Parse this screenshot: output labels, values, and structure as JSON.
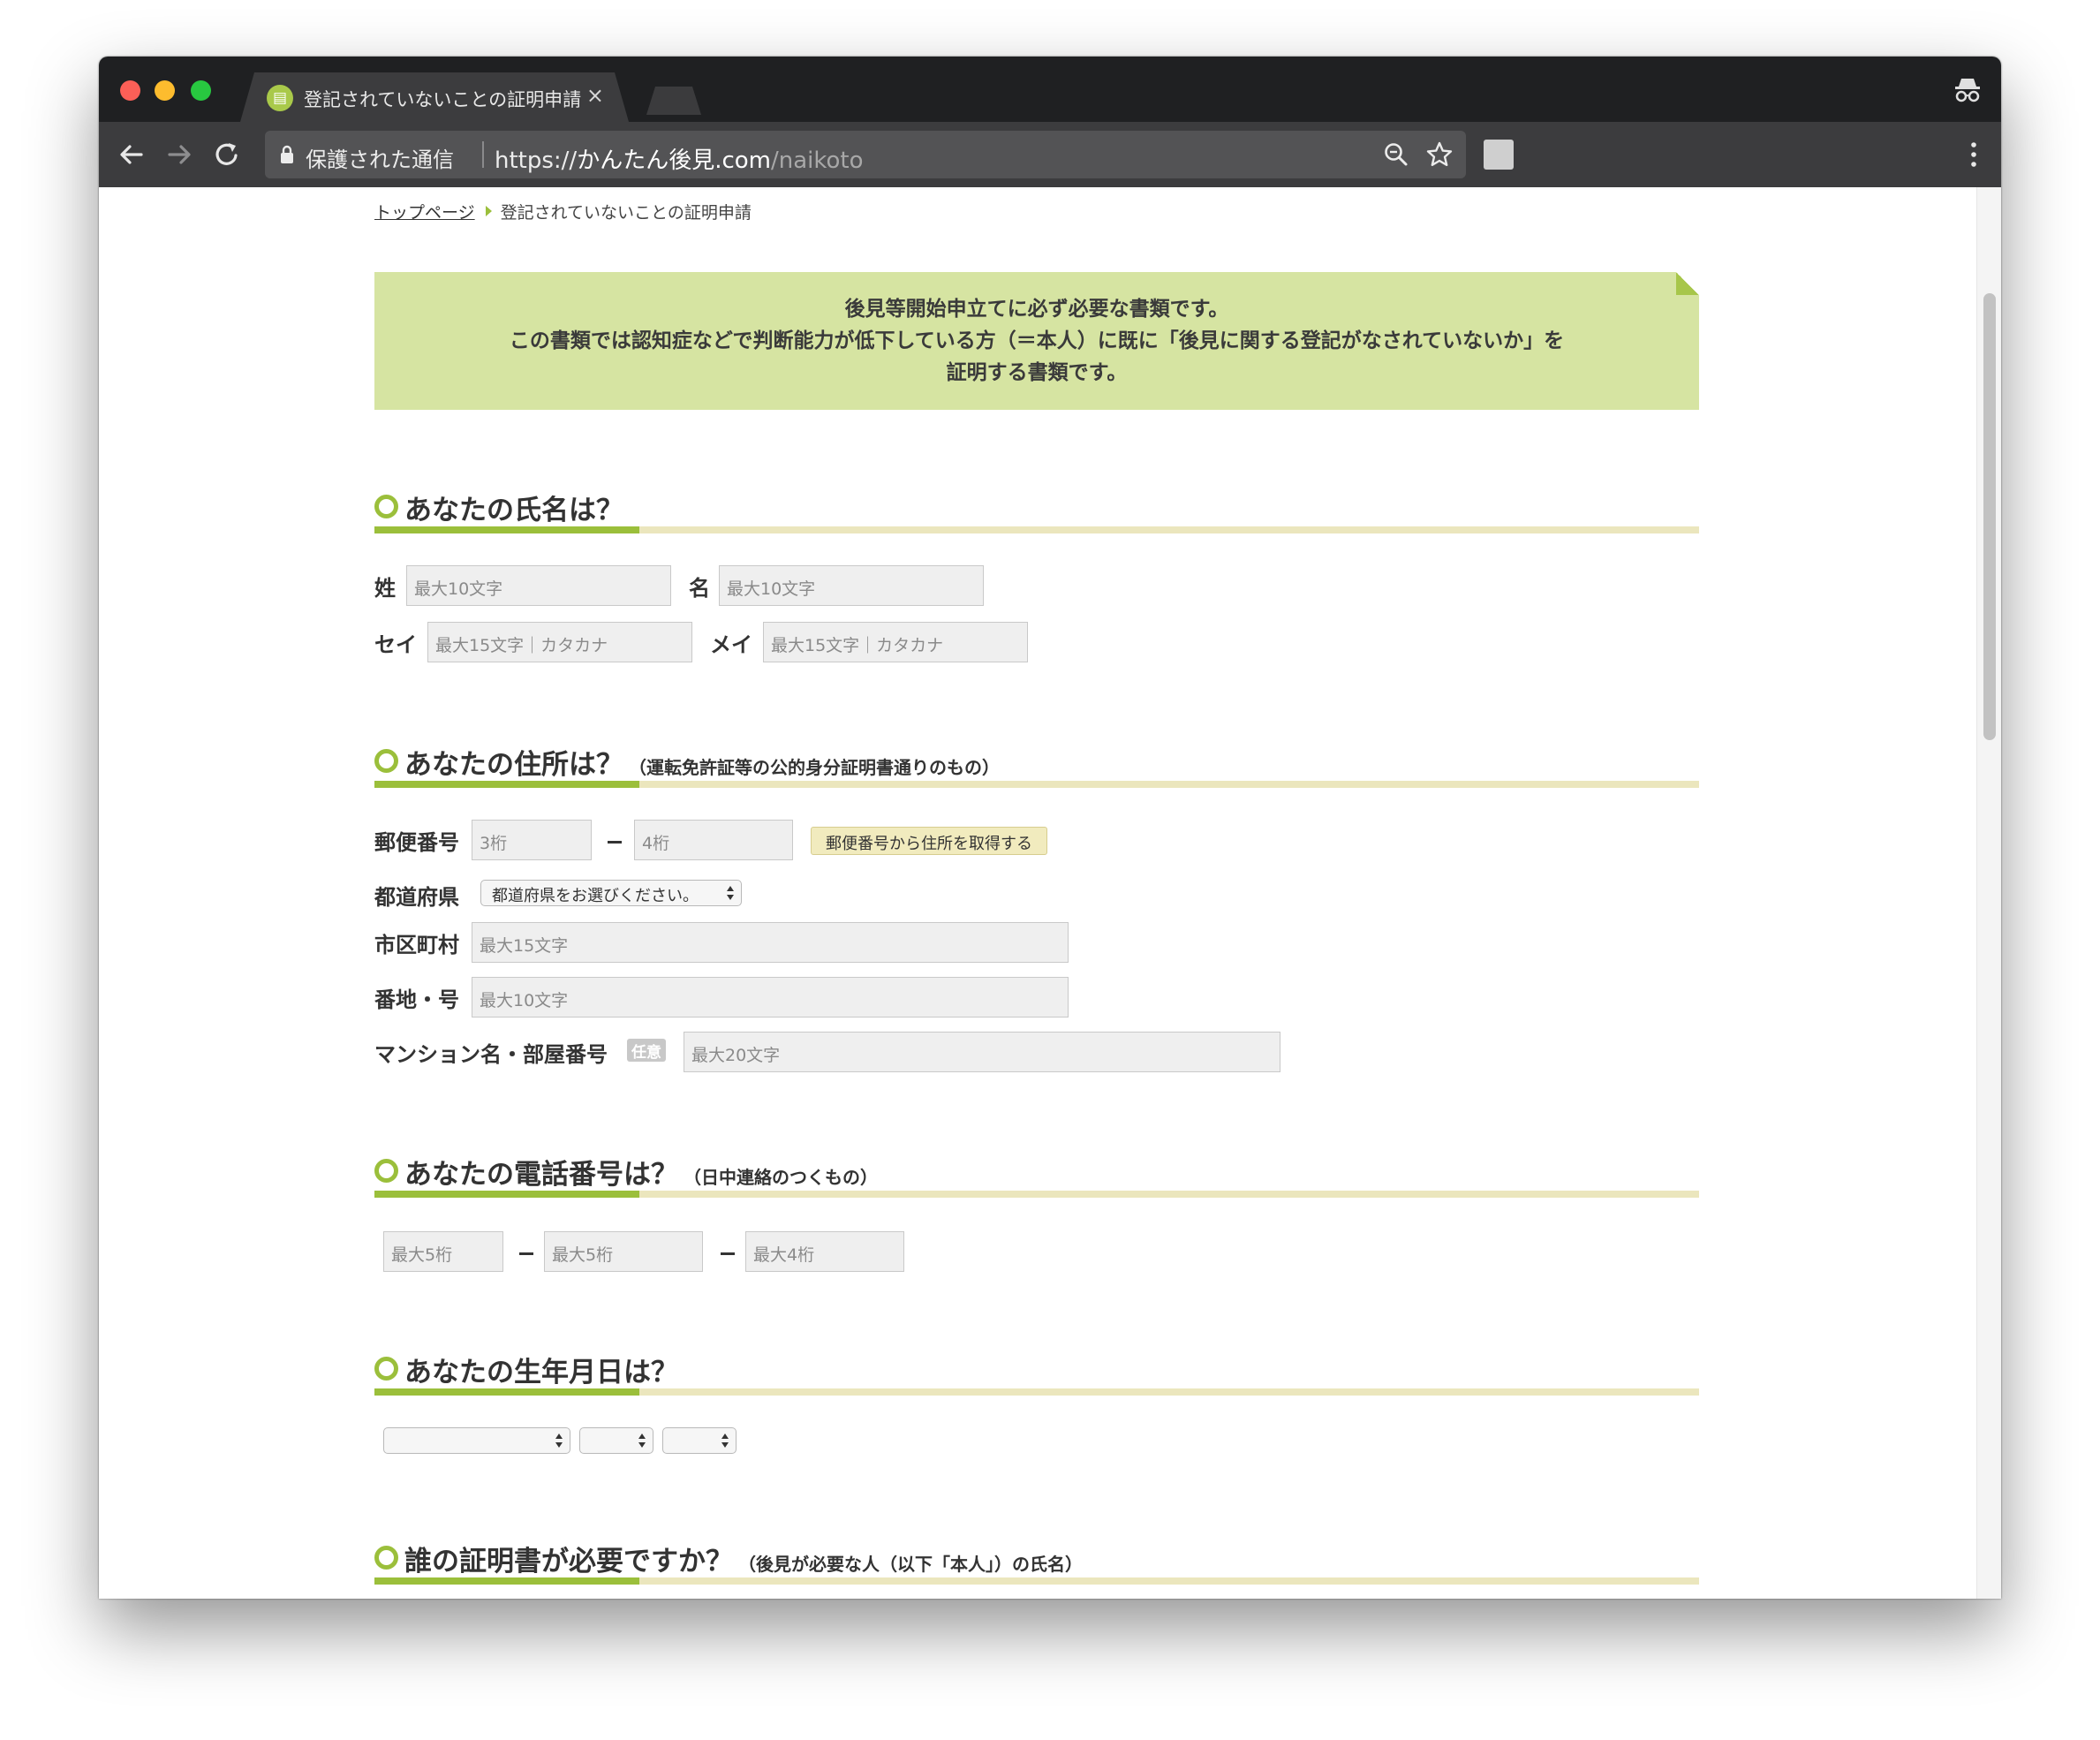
{
  "browser": {
    "tab_title": "登記されていないことの証明申請",
    "tab_close": "×",
    "secure_label": "保護された通信",
    "url_scheme": "https://",
    "url_host": "かんたん後見.com",
    "url_path": "/naikoto"
  },
  "breadcrumb": {
    "home": "トップページ",
    "current": "登記されていないことの証明申請"
  },
  "notice": {
    "line1": "後見等開始申立てに必ず必要な書類です。",
    "line2": "この書類では認知症などで判断能力が低下している方（＝本人）に既に「後見に関する登記がなされていないか」を",
    "line3": "証明する書類です。"
  },
  "name_section": {
    "title": "あなたの氏名は？",
    "sei_label": "姓",
    "sei_placeholder": "最大10文字",
    "mei_label": "名",
    "mei_placeholder": "最大10文字",
    "sei_kana_label": "セイ",
    "sei_kana_placeholder": "最大15文字｜カタカナ",
    "mei_kana_label": "メイ",
    "mei_kana_placeholder": "最大15文字｜カタカナ"
  },
  "address_section": {
    "title": "あなたの住所は？",
    "subtitle": "（運転免許証等の公的身分証明書通りのもの）",
    "zip_label": "郵便番号",
    "zip1_placeholder": "3桁",
    "zip2_placeholder": "4桁",
    "zip_button": "郵便番号から住所を取得する",
    "pref_label": "都道府県",
    "pref_select": "都道府県をお選びください。",
    "city_label": "市区町村",
    "city_placeholder": "最大15文字",
    "block_label": "番地・号",
    "block_placeholder": "最大10文字",
    "building_label": "マンション名・部屋番号",
    "optional_badge": "任意",
    "building_placeholder": "最大20文字"
  },
  "phone_section": {
    "title": "あなたの電話番号は？",
    "subtitle": "（日中連絡のつくもの）",
    "p1_placeholder": "最大5桁",
    "p2_placeholder": "最大5桁",
    "p3_placeholder": "最大4桁"
  },
  "birth_section": {
    "title": "あなたの生年月日は？"
  },
  "subject_section": {
    "title": "誰の証明書が必要ですか？",
    "subtitle": "（後見が必要な人（以下「本人」）の氏名）"
  }
}
